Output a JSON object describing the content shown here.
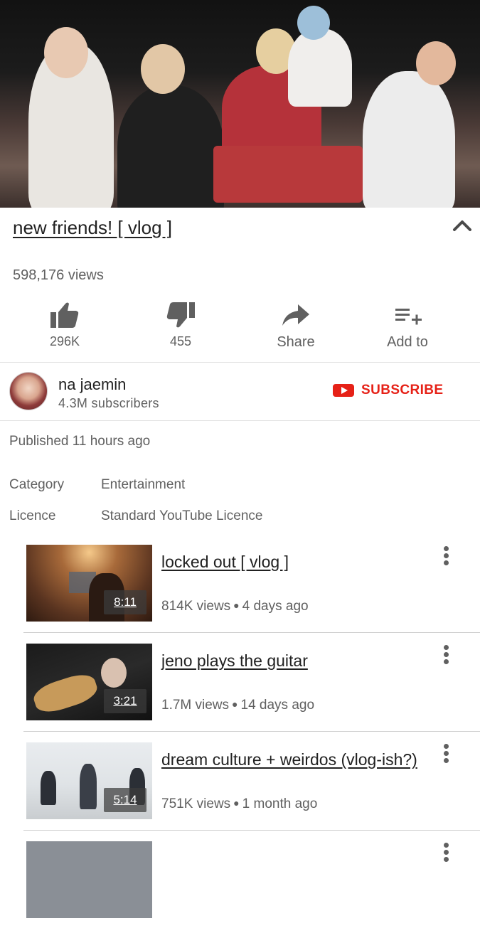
{
  "video": {
    "title": "new friends! [ vlog ]",
    "views": "598,176 views"
  },
  "actions": {
    "like_count": "296K",
    "dislike_count": "455",
    "share_label": "Share",
    "add_label": "Add to"
  },
  "channel": {
    "name": "na jaemin",
    "subscribers": "4.3M subscribers",
    "subscribe_label": "SUBSCRIBE"
  },
  "details": {
    "published": "Published 11 hours ago",
    "category_label": "Category",
    "category_value": "Entertainment",
    "licence_label": "Licence",
    "licence_value": "Standard YouTube Licence"
  },
  "related": [
    {
      "title": "locked out [ vlog ]",
      "duration": "8:11",
      "views": "814K views",
      "age": "4 days ago"
    },
    {
      "title": "jeno plays the guitar",
      "duration": "3:21",
      "views": "1.7M views",
      "age": "14 days ago"
    },
    {
      "title": "dream culture + weirdos (vlog-ish?)",
      "duration": "5:14",
      "views": "751K views",
      "age": "1 month ago"
    }
  ],
  "icons": {
    "collapse": "chevron-up-icon",
    "like": "thumbs-up-icon",
    "dislike": "thumbs-down-icon",
    "share": "share-arrow-icon",
    "add": "playlist-add-icon",
    "more": "more-vertical-icon",
    "subscribe": "youtube-logo-icon"
  },
  "colors": {
    "subscribe_red": "#e62117",
    "secondary_text": "#606060",
    "primary_text": "#212121"
  }
}
